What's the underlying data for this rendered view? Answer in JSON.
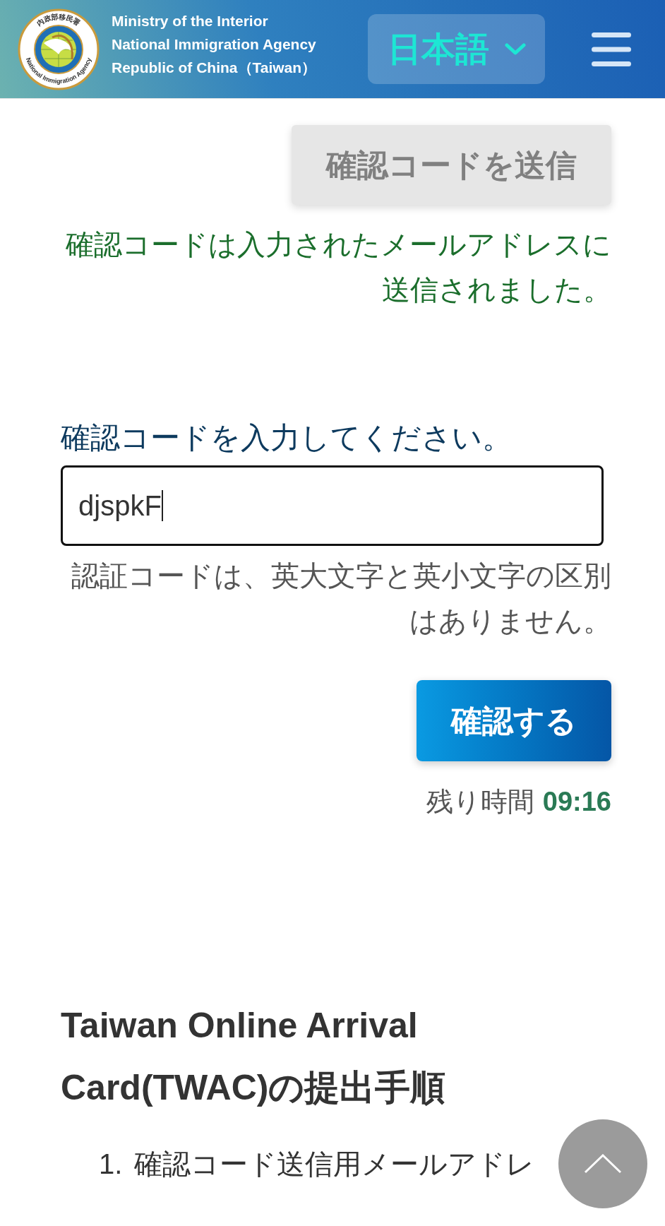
{
  "header": {
    "logo": {
      "ring_text_top": "內政部移民署",
      "ring_text_bottom": "National Immigration Agency"
    },
    "org_lines": [
      "Ministry of the Interior",
      "National Immigration Agency",
      "Republic of China（Taiwan）"
    ],
    "language_selector": {
      "label": "日本語"
    }
  },
  "send_code_button": {
    "label": "確認コードを送信",
    "disabled": true
  },
  "sent_message": "確認コードは入力されたメールアドレスに送信されました。",
  "code_field": {
    "label": "確認コードを入力してください。",
    "value": "djspkF",
    "focused": true
  },
  "case_hint": "認証コードは、英大文字と英小文字の区別はありません。",
  "confirm_button": {
    "label": "確認する",
    "disabled": false
  },
  "timer": {
    "label": "残り時間",
    "value": "09:16"
  },
  "procedure": {
    "heading": "Taiwan Online Arrival Card(TWAC)の提出手順",
    "steps": [
      {
        "number": "1.",
        "text": "確認コード送信用メールアドレ"
      }
    ]
  }
}
